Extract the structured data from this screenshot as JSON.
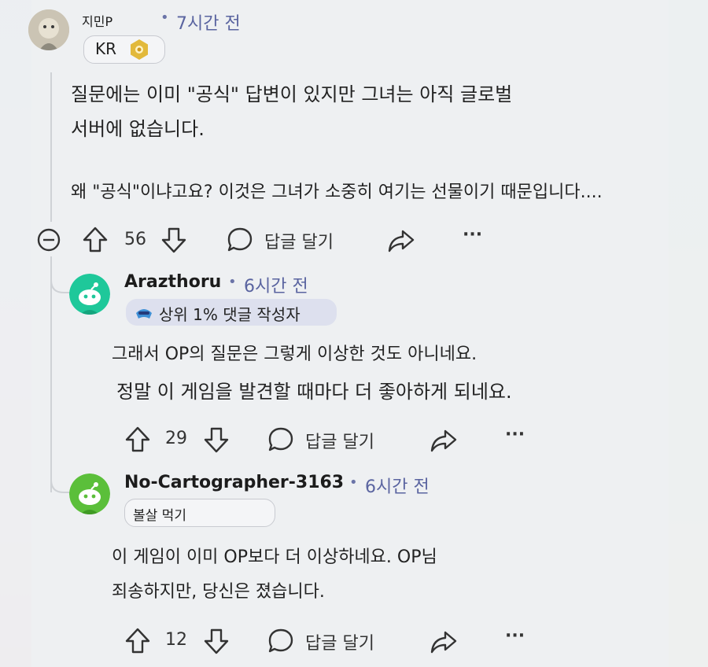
{
  "comment1": {
    "username": "지민P",
    "time": "7시간 전",
    "flair": "KR",
    "body": {
      "line1": "질문에는 이미 \"공식\" 답변이 있지만 그녀는 아직 글로벌",
      "line2": "서버에 없습니다.",
      "line3": "왜 \"공식\"이냐고요? 이것은 그녀가 소중히 여기는 선물이기 때문입니다...."
    },
    "votes": "56",
    "reply_label": "답글 달기"
  },
  "comment2": {
    "username": "Arazthoru",
    "time": "6시간 전",
    "badge": "상위 1% 댓글 작성자",
    "body": {
      "line1": "그래서 OP의 질문은 그렇게 이상한 것도 아니네요.",
      "line2": "정말 이 게임을 발견할 때마다 더 좋아하게 되네요."
    },
    "votes": "29",
    "reply_label": "답글 달기"
  },
  "comment3": {
    "username": "No-Cartographer-3163",
    "time": "6시간 전",
    "flair": "볼살 먹기",
    "body": {
      "line1": "이 게임이 이미 OP보다 더 이상하네요. OP님",
      "line2": "죄송하지만, 당신은 졌습니다."
    },
    "votes": "12",
    "reply_label": "답글 달기"
  },
  "icons": {
    "collapse": "minus-circle-icon",
    "upvote": "arrow-up-icon",
    "downvote": "arrow-down-icon",
    "reply": "speech-bubble-icon",
    "share": "share-arrow-icon",
    "more": "ellipsis-icon"
  },
  "colors": {
    "time": "#5a64a0",
    "avatar2": "#1ec89a",
    "avatar3": "#5bbf3a",
    "badge_bg": "#dde0ee"
  }
}
